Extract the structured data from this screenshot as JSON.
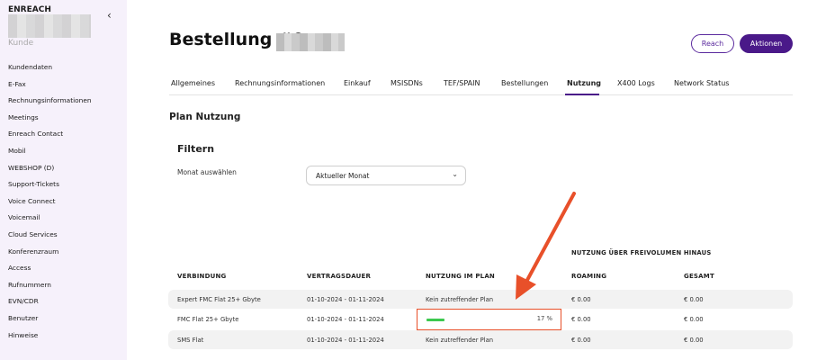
{
  "sidebar": {
    "brand": "ENREACH",
    "subtitle": "Kunde",
    "items": [
      {
        "label": "Kundendaten"
      },
      {
        "label": "E-Fax"
      },
      {
        "label": "Rechnungsinformationen"
      },
      {
        "label": "Meetings"
      },
      {
        "label": "Enreach Contact"
      },
      {
        "label": "Mobil"
      },
      {
        "label": "WEBSHOP (D)"
      },
      {
        "label": "Support-Tickets"
      },
      {
        "label": "Voice Connect"
      },
      {
        "label": "Voicemail"
      },
      {
        "label": "Cloud Services"
      },
      {
        "label": "Konferenzraum"
      },
      {
        "label": "Access"
      },
      {
        "label": "Rufnummern"
      },
      {
        "label": "EVN/CDR"
      },
      {
        "label": "Benutzer"
      },
      {
        "label": "Hinweise"
      }
    ]
  },
  "header": {
    "title": "Bestellung #0",
    "reach_label": "Reach",
    "aktionen_label": "Aktionen"
  },
  "tabs": [
    {
      "label": "Allgemeines"
    },
    {
      "label": "Rechnungsinformationen"
    },
    {
      "label": "Einkauf"
    },
    {
      "label": "MSISDNs"
    },
    {
      "label": "TEF/SPAIN"
    },
    {
      "label": "Bestellungen"
    },
    {
      "label": "Nutzung",
      "active": true
    },
    {
      "label": "X400 Logs"
    },
    {
      "label": "Network Status"
    }
  ],
  "plan": {
    "heading": "Plan Nutzung",
    "filter_heading": "Filtern",
    "month_label": "Monat auswählen",
    "month_value": "Aktueller Monat"
  },
  "table": {
    "group_header": "NUTZUNG ÜBER FREIVOLUMEN HINAUS",
    "columns": [
      "VERBINDUNG",
      "VERTRAGSDAUER",
      "NUTZUNG IM PLAN",
      "ROAMING",
      "GESAMT"
    ],
    "rows": [
      {
        "verbindung": "Expert FMC Flat 25+ Gbyte",
        "dauer": "01-10-2024 - 01-11-2024",
        "nutzung": "Kein zutreffender Plan",
        "roaming": "€ 0.00",
        "gesamt": "€ 0.00"
      },
      {
        "verbindung": "FMC Flat 25+ Gbyte",
        "dauer": "01-10-2024 - 01-11-2024",
        "nutzung_percent": "17 %",
        "roaming": "€ 0.00",
        "gesamt": "€ 0.00"
      },
      {
        "verbindung": "SMS Flat",
        "dauer": "01-10-2024 - 01-11-2024",
        "nutzung": "Kein zutreffender Plan",
        "roaming": "€ 0.00",
        "gesamt": "€ 0.00"
      }
    ]
  },
  "colors": {
    "accent": "#4a1989",
    "progress": "#3cc84f",
    "highlight": "#e8502a",
    "sidebar_bg": "#f6f1fb"
  }
}
